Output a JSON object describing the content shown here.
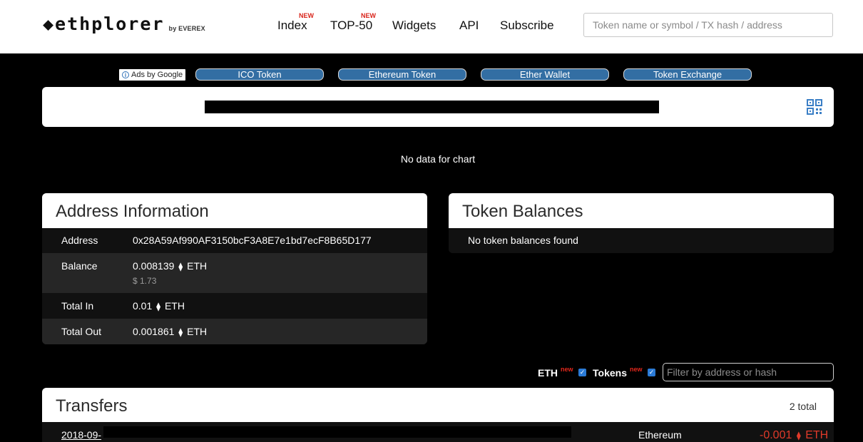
{
  "header": {
    "logo": "◆ethplorer",
    "logo_by": "by EVEREX",
    "nav": [
      {
        "label": "Index",
        "badge": "NEW"
      },
      {
        "label": "TOP-50",
        "badge": "NEW"
      },
      {
        "label": "Widgets"
      },
      {
        "label": "API"
      },
      {
        "label": "Subscribe"
      }
    ],
    "search_placeholder": "Token name or symbol / TX hash / address"
  },
  "ads": {
    "label": "Ads by Google",
    "buttons": [
      "ICO Token",
      "Ethereum Token",
      "Ether Wallet",
      "Token Exchange"
    ]
  },
  "chart": {
    "empty_text": "No data for chart"
  },
  "address_info": {
    "title": "Address Information",
    "rows": [
      {
        "label": "Address",
        "value": "0x28A59Af990AF3150bcF3A8E7e1bd7ecF8B65D177"
      },
      {
        "label": "Balance",
        "value": "0.008139",
        "unit": "ETH",
        "usd": "$ 1.73"
      },
      {
        "label": "Total In",
        "value": "0.01",
        "unit": "ETH"
      },
      {
        "label": "Total Out",
        "value": "0.001861",
        "unit": "ETH"
      }
    ]
  },
  "token_balances": {
    "title": "Token Balances",
    "empty_text": "No token balances found"
  },
  "filters": {
    "eth_label": "ETH",
    "tokens_label": "Tokens",
    "new_badge": "new",
    "eth_checked": true,
    "tokens_checked": true,
    "filter_placeholder": "Filter by address or hash"
  },
  "transfers": {
    "title": "Transfers",
    "total": "2 total",
    "rows": [
      {
        "date": "2018-09-",
        "token": "Ethereum",
        "amount": "-0.001",
        "unit": "ETH"
      }
    ]
  },
  "colors": {
    "accent_blue": "#336ea3",
    "negative_red": "#e13a2a",
    "badge_red": "#d9261c"
  }
}
